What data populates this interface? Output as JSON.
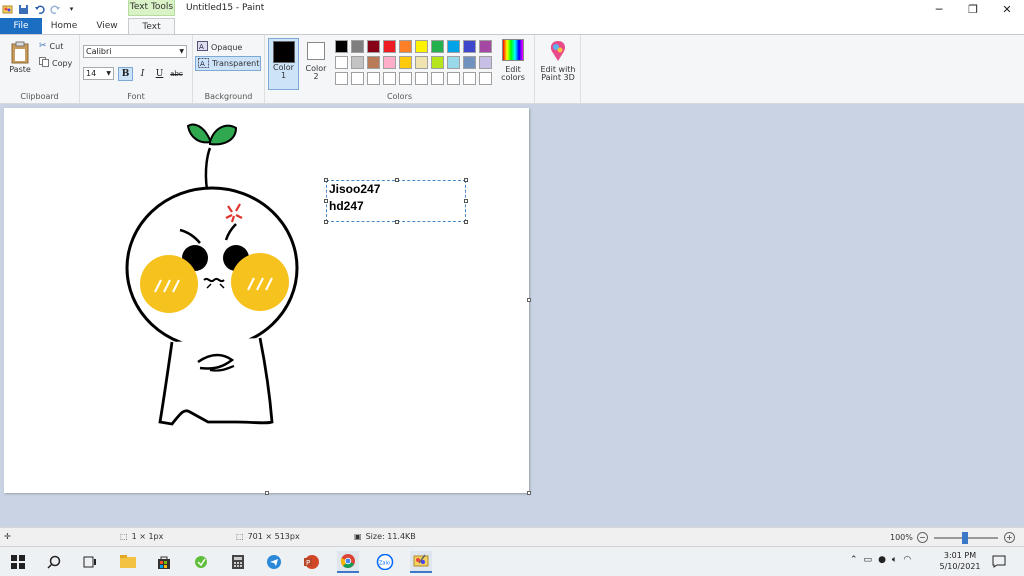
{
  "window": {
    "title": "Untitled15 - Paint",
    "context_tab": "Text Tools"
  },
  "tabs": [
    "File",
    "Home",
    "View",
    "Text"
  ],
  "ribbon": {
    "clipboard": {
      "paste": "Paste",
      "cut": "Cut",
      "copy": "Copy",
      "label": "Clipboard"
    },
    "font": {
      "family": "Calibri",
      "size": "14",
      "bold": "B",
      "italic": "I",
      "underline": "U",
      "strike": "abc",
      "label": "Font"
    },
    "background": {
      "opaque": "Opaque",
      "transparent": "Transparent",
      "label": "Background"
    },
    "colors": {
      "color1": "Color",
      "color1_num": "1",
      "color2": "Color",
      "color2_num": "2",
      "edit_colors": "Edit",
      "edit_colors2": "colors",
      "label": "Colors",
      "palette_row1": [
        "#000000",
        "#7f7f7f",
        "#880015",
        "#ed1c24",
        "#ff7f27",
        "#fff200",
        "#22b14c",
        "#00a2e8",
        "#3f48cc",
        "#a349a4"
      ],
      "palette_row2": [
        "#ffffff",
        "#c3c3c3",
        "#b97a57",
        "#ffaec9",
        "#ffc90e",
        "#efe4b0",
        "#b5e61d",
        "#99d9ea",
        "#7092be",
        "#c8bfe7"
      ],
      "palette_row3": [
        "#ffffff",
        "#ffffff",
        "#ffffff",
        "#ffffff",
        "#ffffff",
        "#ffffff",
        "#ffffff",
        "#ffffff",
        "#ffffff",
        "#ffffff"
      ]
    },
    "paint3d": {
      "line1": "Edit with",
      "line2": "Paint 3D"
    }
  },
  "canvas": {
    "text_lines": [
      "Jisoo247",
      "hd247"
    ]
  },
  "status": {
    "pen_size": "1 × 1px",
    "canvas_size": "701 × 513px",
    "file_size": "Size: 11.4KB",
    "zoom": "100%"
  },
  "taskbar": {
    "time": "3:01 PM",
    "date": "5/10/2021"
  }
}
